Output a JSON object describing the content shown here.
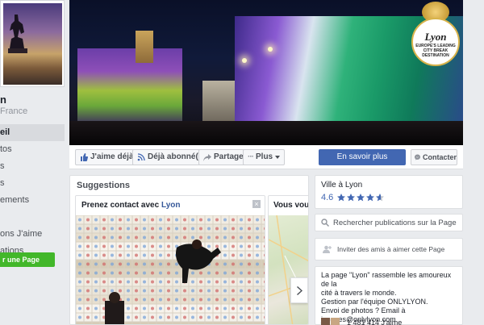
{
  "sidebar": {
    "page_name": "n",
    "page_sub": "France",
    "nav_items": [
      {
        "label": "eil",
        "active": true
      },
      {
        "label": "tos",
        "active": false
      },
      {
        "label": "s",
        "active": false
      },
      {
        "label": "s",
        "active": false
      },
      {
        "label": "ements",
        "active": false
      },
      {
        "label": "",
        "active": false
      },
      {
        "label": "ons J'aime",
        "active": false
      },
      {
        "label": "ations",
        "active": false
      }
    ],
    "create_page_label": "r une Page"
  },
  "cover": {
    "badge_name": "Lyon",
    "badge_lines": [
      "EUROPE'S LEADING",
      "CITY BREAK",
      "DESTINATION"
    ]
  },
  "action_bar": {
    "like_label": "J'aime déjà",
    "follow_label": "Déjà abonné(e)",
    "share_label": "Partager",
    "more_label": "Plus",
    "primary_label": "En savoir plus",
    "contact_label": "Contacter"
  },
  "suggestions": {
    "title": "Suggestions",
    "card_prefix": "Prenez contact avec",
    "card_link": "Lyon",
    "card2_title": "Vous vous tr"
  },
  "right": {
    "rating_title": "Ville à Lyon",
    "rating_value": "4.6",
    "rating_stars": 4.6,
    "search_label": "Rechercher publications sur la Page",
    "invite_label": "Inviter des amis à aimer cette Page",
    "about_lines": [
      "La page \"Lyon\" rassemble les amoureux de la",
      "cité à travers le monde.",
      "Gestion par l'équipe ONLYLYON.",
      "Envoi de photos ? Email à",
      "jacques@onlylyon.com"
    ],
    "likes_text": "1 481 414 J'aime"
  },
  "colors": {
    "brand_blue": "#4267b2",
    "link_blue": "#365899",
    "green": "#42b72a"
  }
}
